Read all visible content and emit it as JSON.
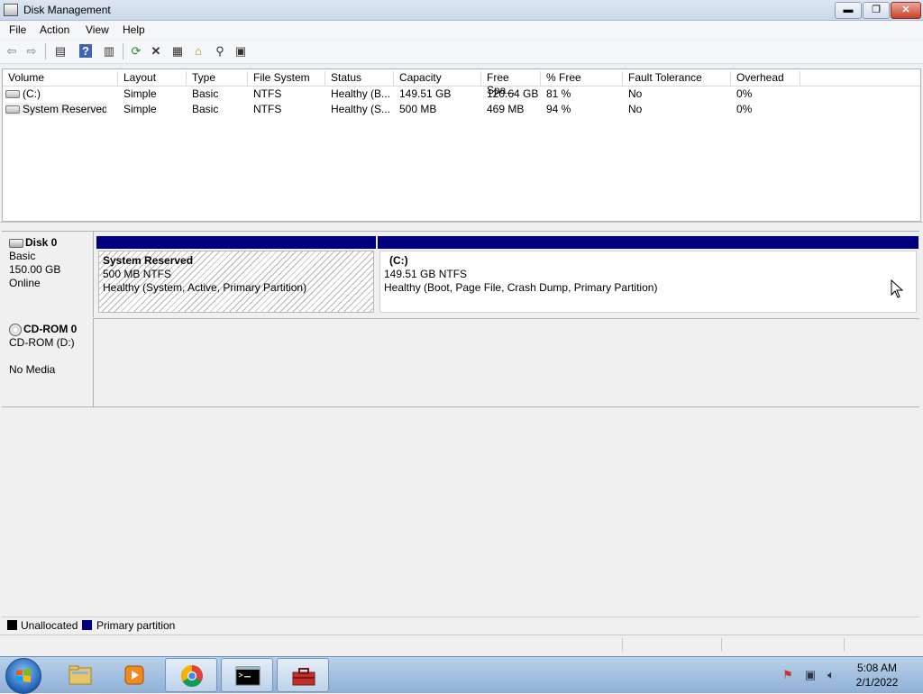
{
  "window": {
    "title": "Disk Management",
    "minimize": "▬",
    "maximize": "❐",
    "close": "✕"
  },
  "menu": [
    "File",
    "Action",
    "View",
    "Help"
  ],
  "toolbar": [
    {
      "name": "back-icon",
      "glyph": "⇦"
    },
    {
      "name": "forward-icon",
      "glyph": "⇨"
    },
    {
      "name": "console-tree-icon",
      "glyph": "▤"
    },
    {
      "name": "help-icon",
      "glyph": "?"
    },
    {
      "name": "properties-view-icon",
      "glyph": "▥"
    },
    {
      "name": "refresh-icon",
      "glyph": "⟳"
    },
    {
      "name": "delete-icon",
      "glyph": "✕"
    },
    {
      "name": "properties-icon",
      "glyph": "▦"
    },
    {
      "name": "open-icon",
      "glyph": "⌂"
    },
    {
      "name": "search-icon",
      "glyph": "⚲"
    },
    {
      "name": "settings-icon",
      "glyph": "▣"
    }
  ],
  "volume_list": {
    "columns": [
      "Volume",
      "Layout",
      "Type",
      "File System",
      "Status",
      "Capacity",
      "Free Spa...",
      "% Free",
      "Fault Tolerance",
      "Overhead"
    ],
    "rows": [
      {
        "volume": "(C:)",
        "layout": "Simple",
        "type": "Basic",
        "fs": "NTFS",
        "status": "Healthy (B...",
        "capacity": "149.51 GB",
        "free": "120.64 GB",
        "pct_free": "81 %",
        "fault": "No",
        "overhead": "0%"
      },
      {
        "volume": "System Reserved",
        "layout": "Simple",
        "type": "Basic",
        "fs": "NTFS",
        "status": "Healthy (S...",
        "capacity": "500 MB",
        "free": "469 MB",
        "pct_free": "94 %",
        "fault": "No",
        "overhead": "0%"
      }
    ]
  },
  "disks": [
    {
      "name": "Disk 0",
      "kind": "Basic",
      "size": "150.00 GB",
      "state": "Online",
      "partitions": [
        {
          "name": "System Reserved",
          "size": "500 MB NTFS",
          "status": "Healthy (System, Active, Primary Partition)"
        },
        {
          "name": "(C:)",
          "size": "149.51 GB NTFS",
          "status": "Healthy (Boot, Page File, Crash Dump, Primary Partition)"
        }
      ]
    },
    {
      "name": "CD-ROM 0",
      "kind": "CD-ROM (D:)",
      "size": "",
      "state": "No Media"
    }
  ],
  "legend": [
    {
      "label": "Unallocated",
      "color": "#000000"
    },
    {
      "label": "Primary partition",
      "color": "#00007f"
    }
  ],
  "taskbar": {
    "apps": [
      "Windows Explorer",
      "Windows Media Player",
      "Google Chrome",
      "Command Prompt",
      "Computer Management"
    ],
    "time": "5:08 AM",
    "date": "2/1/2022"
  },
  "colors": {
    "primary_partition": "#00007f",
    "taskbar": "#a9c4e4"
  }
}
